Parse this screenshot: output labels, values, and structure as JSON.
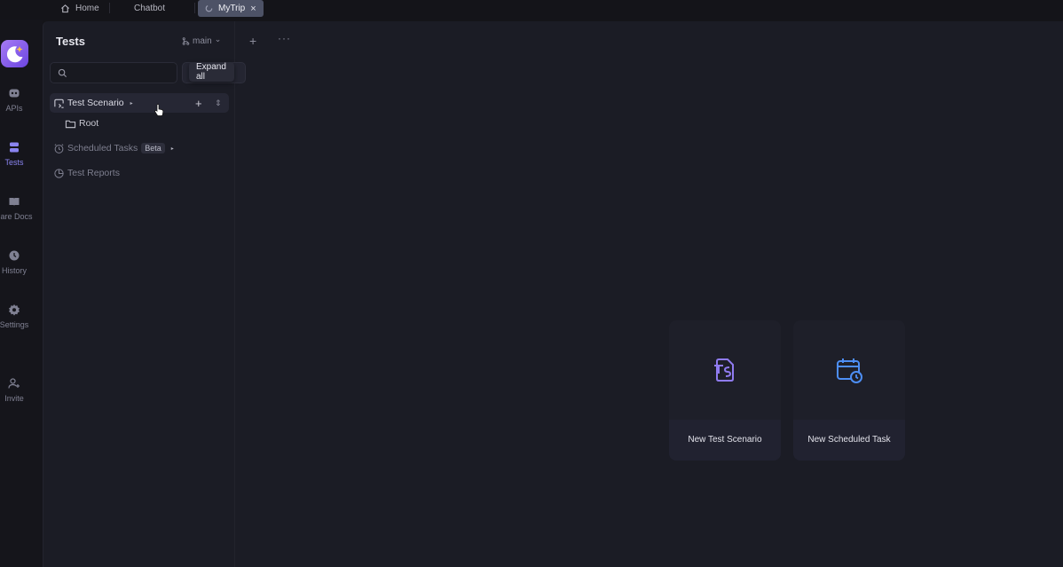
{
  "tabs": [
    {
      "label": "Home",
      "icon": "home-icon"
    },
    {
      "label": "Chatbot"
    },
    {
      "label": "MyTrip",
      "icon": "loading-icon",
      "close": "×",
      "active": true
    }
  ],
  "rail": {
    "items": [
      {
        "label": "APIs",
        "icon": "api-icon"
      },
      {
        "label": "Tests",
        "icon": "tests-icon",
        "active": true
      },
      {
        "label": "hare Docs",
        "icon": "docs-icon"
      },
      {
        "label": "History",
        "icon": "history-icon"
      },
      {
        "label": "Settings",
        "icon": "settings-icon"
      },
      {
        "label": "Invite",
        "icon": "invite-icon"
      }
    ]
  },
  "panel": {
    "title": "Tests",
    "branch": "main",
    "branch_chevron": "⌄",
    "add": "+",
    "more": "···",
    "search_placeholder": "",
    "tooltip": "Expand all"
  },
  "tree": {
    "test_scenario": {
      "label": "Test Scenario",
      "caret": "▸",
      "add": "+",
      "updown": "⇕"
    },
    "root": {
      "label": "Root"
    },
    "scheduled": {
      "label": "Scheduled Tasks",
      "badge": "Beta",
      "caret": "▸"
    },
    "reports": {
      "label": "Test Reports"
    }
  },
  "main": {
    "cards": [
      {
        "label": "New Test Scenario",
        "icon": "ts-file-icon",
        "color": "#8f7bf0"
      },
      {
        "label": "New Scheduled Task",
        "icon": "calendar-clock-icon",
        "color": "#4d8ef5"
      }
    ]
  },
  "colors": {
    "accent": "#8a84f0",
    "background": "#141419",
    "panel": "#1b1c25"
  }
}
